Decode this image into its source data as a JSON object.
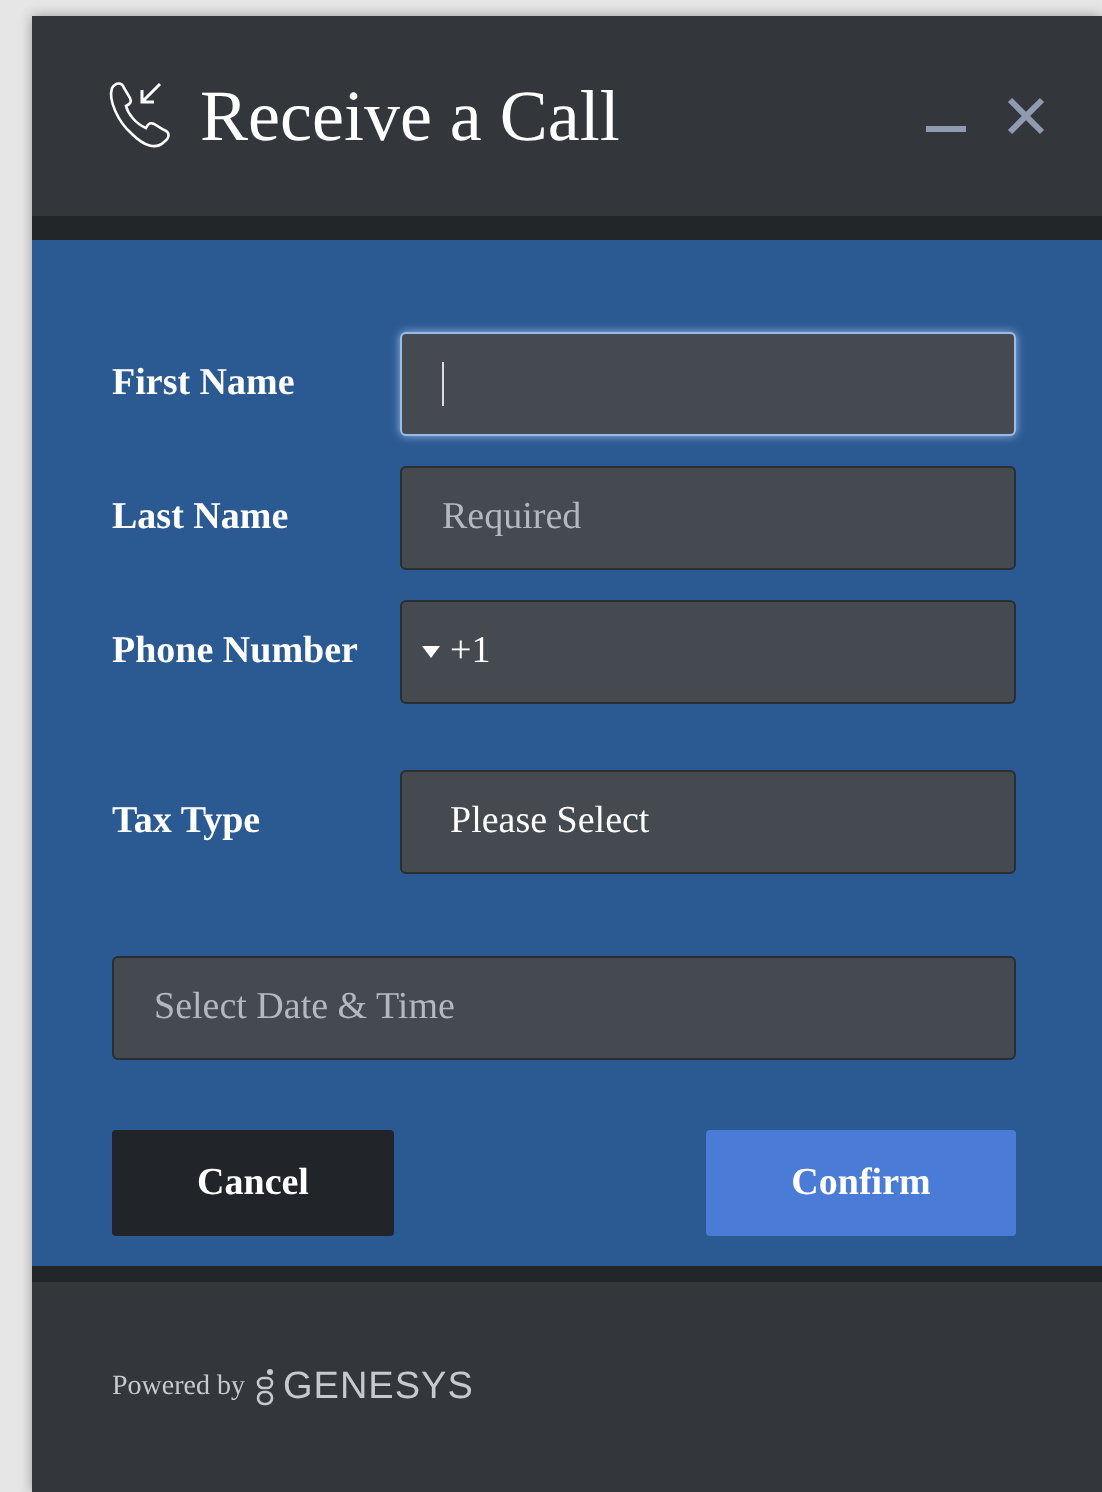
{
  "window": {
    "title": "Receive a Call"
  },
  "fields": [
    {
      "kind": "text",
      "label": "First Name",
      "focused": true
    },
    {
      "kind": "text",
      "label": "Last Name",
      "placeholder": "Required",
      "focused": false
    },
    {
      "kind": "phone",
      "label": "Phone Number",
      "value": "+1",
      "focused": false
    },
    {
      "kind": "select",
      "label": "Tax Type",
      "value": "Please Select",
      "focused": false
    },
    {
      "kind": "datetime",
      "placeholder": "Select Date & Time",
      "focused": false
    }
  ],
  "buttons": [
    {
      "label": "Cancel",
      "kind": "secondary"
    },
    {
      "label": "Confirm",
      "kind": "primary"
    }
  ],
  "footer": {
    "powered_by": "Powered by",
    "brand": "GENESYS"
  }
}
